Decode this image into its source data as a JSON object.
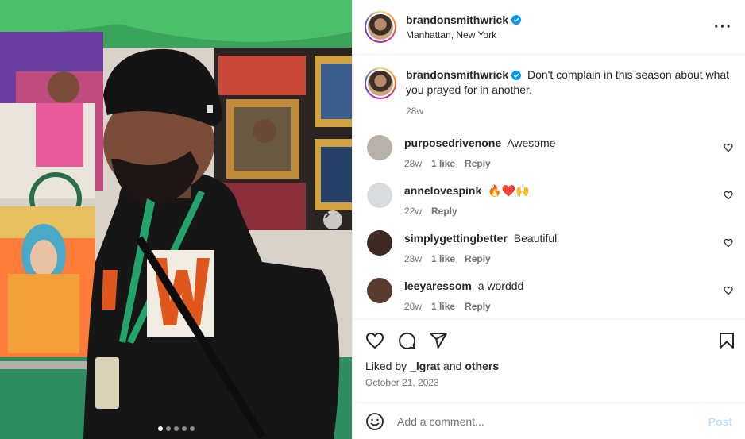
{
  "post": {
    "username": "brandonsmithwrick",
    "location": "Manhattan, New York",
    "more_icon": "more-horizontal-icon",
    "caption": "Don't complain in this season about what you prayed for in another.",
    "caption_age": "28w",
    "carousel": {
      "slide_count": 5,
      "active_index": 0
    }
  },
  "comments": [
    {
      "username": "purposedrivenone",
      "text": "Awesome",
      "age": "28w",
      "likes": "1 like",
      "reply": "Reply",
      "avatar_color": "#b8b2aa"
    },
    {
      "username": "annelovespink",
      "text": "🔥❤️🙌",
      "age": "22w",
      "likes": "",
      "reply": "Reply",
      "avatar_color": "#d9dcdf"
    },
    {
      "username": "simplygettingbetter",
      "text": "Beautiful",
      "age": "28w",
      "likes": "1 like",
      "reply": "Reply",
      "avatar_color": "#3e2a22"
    },
    {
      "username": "leeyaressom",
      "text": "a worddd",
      "age": "28w",
      "likes": "1 like",
      "reply": "Reply",
      "avatar_color": "#5b3b30"
    }
  ],
  "engagement": {
    "liked_by_prefix": "Liked by ",
    "liked_by_user": "_lgrat",
    "liked_by_and": " and ",
    "liked_by_others": "others",
    "date": "October 21, 2023"
  },
  "composer": {
    "placeholder": "Add a comment...",
    "post_label": "Post"
  },
  "colors": {
    "verified": "#0095f6",
    "post_disabled": "#c0dffd",
    "meta_gray": "#737373"
  }
}
